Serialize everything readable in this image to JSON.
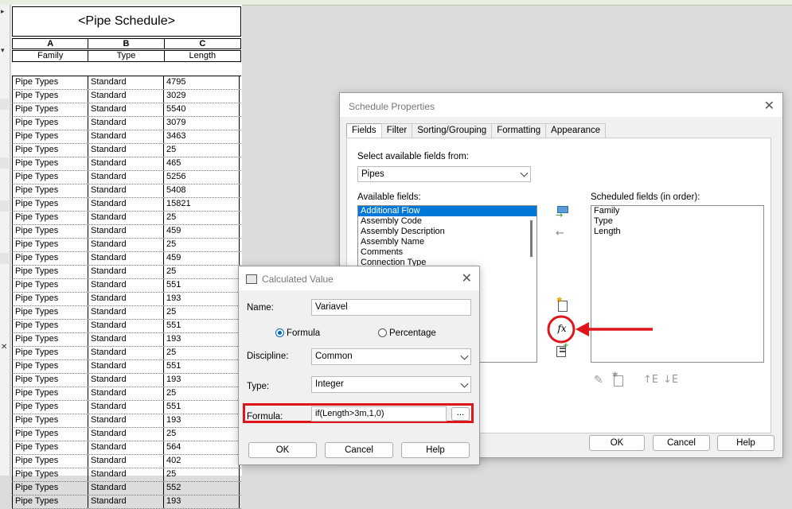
{
  "schedule": {
    "title": "<Pipe Schedule>",
    "column_letters": [
      "A",
      "B",
      "C"
    ],
    "column_headers": [
      "Family",
      "Type",
      "Length"
    ],
    "rows": [
      [
        "Pipe Types",
        "Standard",
        "4795"
      ],
      [
        "Pipe Types",
        "Standard",
        "3029"
      ],
      [
        "Pipe Types",
        "Standard",
        "5540"
      ],
      [
        "Pipe Types",
        "Standard",
        "3079"
      ],
      [
        "Pipe Types",
        "Standard",
        "3463"
      ],
      [
        "Pipe Types",
        "Standard",
        "25"
      ],
      [
        "Pipe Types",
        "Standard",
        "465"
      ],
      [
        "Pipe Types",
        "Standard",
        "5256"
      ],
      [
        "Pipe Types",
        "Standard",
        "5408"
      ],
      [
        "Pipe Types",
        "Standard",
        "15821"
      ],
      [
        "Pipe Types",
        "Standard",
        "25"
      ],
      [
        "Pipe Types",
        "Standard",
        "459"
      ],
      [
        "Pipe Types",
        "Standard",
        "25"
      ],
      [
        "Pipe Types",
        "Standard",
        "459"
      ],
      [
        "Pipe Types",
        "Standard",
        "25"
      ],
      [
        "Pipe Types",
        "Standard",
        "551"
      ],
      [
        "Pipe Types",
        "Standard",
        "193"
      ],
      [
        "Pipe Types",
        "Standard",
        "25"
      ],
      [
        "Pipe Types",
        "Standard",
        "551"
      ],
      [
        "Pipe Types",
        "Standard",
        "193"
      ],
      [
        "Pipe Types",
        "Standard",
        "25"
      ],
      [
        "Pipe Types",
        "Standard",
        "551"
      ],
      [
        "Pipe Types",
        "Standard",
        "193"
      ],
      [
        "Pipe Types",
        "Standard",
        "25"
      ],
      [
        "Pipe Types",
        "Standard",
        "551"
      ],
      [
        "Pipe Types",
        "Standard",
        "193"
      ],
      [
        "Pipe Types",
        "Standard",
        "25"
      ],
      [
        "Pipe Types",
        "Standard",
        "564"
      ],
      [
        "Pipe Types",
        "Standard",
        "402"
      ],
      [
        "Pipe Types",
        "Standard",
        "25"
      ],
      [
        "Pipe Types",
        "Standard",
        "552"
      ],
      [
        "Pipe Types",
        "Standard",
        "193"
      ]
    ]
  },
  "schedule_properties": {
    "title": "Schedule Properties",
    "tabs": [
      "Fields",
      "Filter",
      "Sorting/Grouping",
      "Formatting",
      "Appearance"
    ],
    "select_from_label": "Select available fields from:",
    "select_from_value": "Pipes",
    "available_fields_label": "Available fields:",
    "available_fields": [
      "Additional Flow",
      "Assembly Code",
      "Assembly Description",
      "Assembly Name",
      "Comments",
      "Connection Type"
    ],
    "scheduled_fields_label": "Scheduled fields (in order):",
    "scheduled_fields": [
      "Family",
      "Type",
      "Length"
    ],
    "ok": "OK",
    "cancel": "Cancel",
    "help": "Help",
    "fx_label": "fx"
  },
  "calculated_value": {
    "title": "Calculated Value",
    "name_label": "Name:",
    "name_value": "Variavel",
    "formula_radio": "Formula",
    "percentage_radio": "Percentage",
    "discipline_label": "Discipline:",
    "discipline_value": "Common",
    "type_label": "Type:",
    "type_value": "Integer",
    "formula_label": "Formula:",
    "formula_value": "if(Length>3m,1,0)",
    "browse": "...",
    "ok": "OK",
    "cancel": "Cancel",
    "help": "Help"
  },
  "colors": {
    "annotation_red": "#e0141b",
    "selection_blue": "#0078d7"
  }
}
